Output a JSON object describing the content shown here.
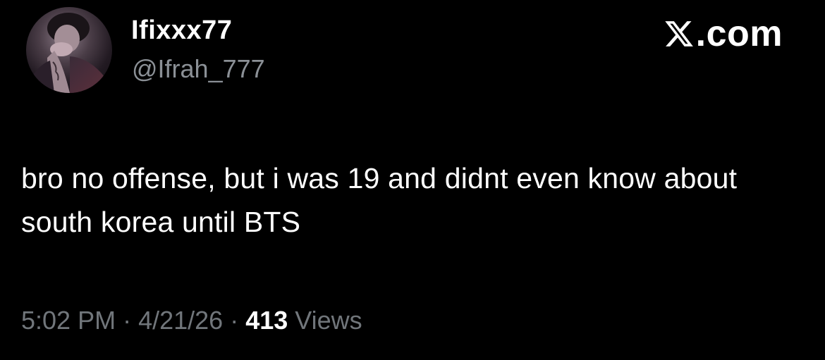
{
  "author": {
    "display_name": "Ifixxx77",
    "handle": "@Ifrah_777",
    "avatar_icon": "avatar-photo"
  },
  "brand": {
    "icon": "x-logo-icon",
    "text": ".com"
  },
  "tweet": {
    "text": "bro no offense, but i was 19 and didnt even know about south korea until BTS"
  },
  "meta": {
    "time": "5:02 PM",
    "separator": "·",
    "date": "4/21/26",
    "views_count": "413",
    "views_label": "Views"
  },
  "colors": {
    "background": "#000000",
    "text_primary": "#ffffff",
    "text_secondary": "#71767b"
  }
}
